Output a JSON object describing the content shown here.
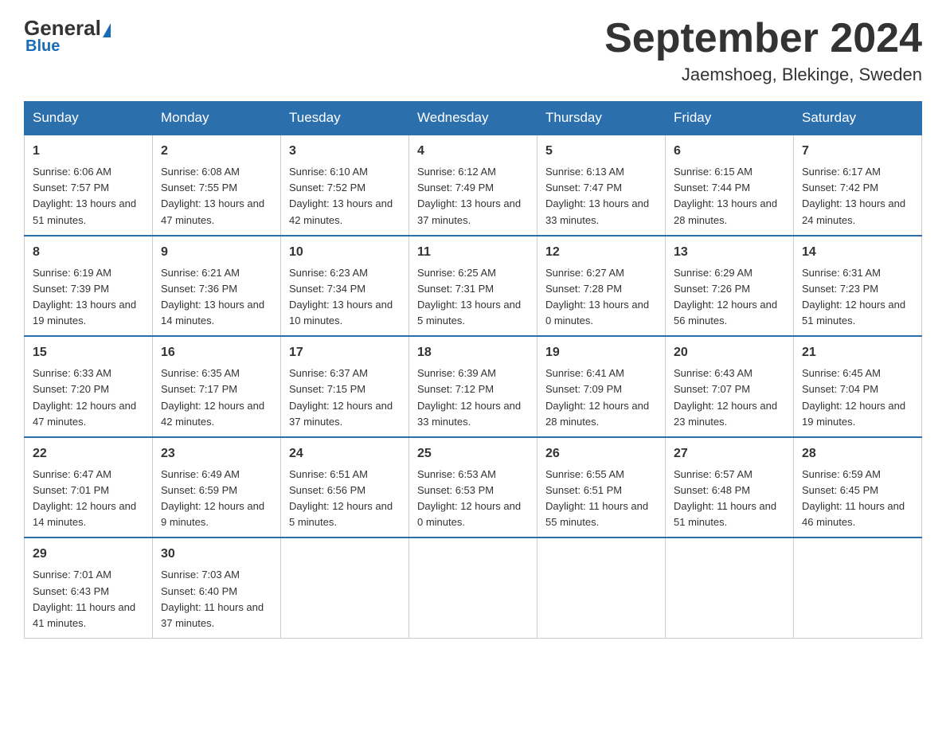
{
  "logo": {
    "general": "General",
    "blue": "Blue",
    "underline": "Blue"
  },
  "title": "September 2024",
  "location": "Jaemshoeg, Blekinge, Sweden",
  "days_of_week": [
    "Sunday",
    "Monday",
    "Tuesday",
    "Wednesday",
    "Thursday",
    "Friday",
    "Saturday"
  ],
  "weeks": [
    [
      {
        "day": "1",
        "sunrise": "6:06 AM",
        "sunset": "7:57 PM",
        "daylight": "13 hours and 51 minutes."
      },
      {
        "day": "2",
        "sunrise": "6:08 AM",
        "sunset": "7:55 PM",
        "daylight": "13 hours and 47 minutes."
      },
      {
        "day": "3",
        "sunrise": "6:10 AM",
        "sunset": "7:52 PM",
        "daylight": "13 hours and 42 minutes."
      },
      {
        "day": "4",
        "sunrise": "6:12 AM",
        "sunset": "7:49 PM",
        "daylight": "13 hours and 37 minutes."
      },
      {
        "day": "5",
        "sunrise": "6:13 AM",
        "sunset": "7:47 PM",
        "daylight": "13 hours and 33 minutes."
      },
      {
        "day": "6",
        "sunrise": "6:15 AM",
        "sunset": "7:44 PM",
        "daylight": "13 hours and 28 minutes."
      },
      {
        "day": "7",
        "sunrise": "6:17 AM",
        "sunset": "7:42 PM",
        "daylight": "13 hours and 24 minutes."
      }
    ],
    [
      {
        "day": "8",
        "sunrise": "6:19 AM",
        "sunset": "7:39 PM",
        "daylight": "13 hours and 19 minutes."
      },
      {
        "day": "9",
        "sunrise": "6:21 AM",
        "sunset": "7:36 PM",
        "daylight": "13 hours and 14 minutes."
      },
      {
        "day": "10",
        "sunrise": "6:23 AM",
        "sunset": "7:34 PM",
        "daylight": "13 hours and 10 minutes."
      },
      {
        "day": "11",
        "sunrise": "6:25 AM",
        "sunset": "7:31 PM",
        "daylight": "13 hours and 5 minutes."
      },
      {
        "day": "12",
        "sunrise": "6:27 AM",
        "sunset": "7:28 PM",
        "daylight": "13 hours and 0 minutes."
      },
      {
        "day": "13",
        "sunrise": "6:29 AM",
        "sunset": "7:26 PM",
        "daylight": "12 hours and 56 minutes."
      },
      {
        "day": "14",
        "sunrise": "6:31 AM",
        "sunset": "7:23 PM",
        "daylight": "12 hours and 51 minutes."
      }
    ],
    [
      {
        "day": "15",
        "sunrise": "6:33 AM",
        "sunset": "7:20 PM",
        "daylight": "12 hours and 47 minutes."
      },
      {
        "day": "16",
        "sunrise": "6:35 AM",
        "sunset": "7:17 PM",
        "daylight": "12 hours and 42 minutes."
      },
      {
        "day": "17",
        "sunrise": "6:37 AM",
        "sunset": "7:15 PM",
        "daylight": "12 hours and 37 minutes."
      },
      {
        "day": "18",
        "sunrise": "6:39 AM",
        "sunset": "7:12 PM",
        "daylight": "12 hours and 33 minutes."
      },
      {
        "day": "19",
        "sunrise": "6:41 AM",
        "sunset": "7:09 PM",
        "daylight": "12 hours and 28 minutes."
      },
      {
        "day": "20",
        "sunrise": "6:43 AM",
        "sunset": "7:07 PM",
        "daylight": "12 hours and 23 minutes."
      },
      {
        "day": "21",
        "sunrise": "6:45 AM",
        "sunset": "7:04 PM",
        "daylight": "12 hours and 19 minutes."
      }
    ],
    [
      {
        "day": "22",
        "sunrise": "6:47 AM",
        "sunset": "7:01 PM",
        "daylight": "12 hours and 14 minutes."
      },
      {
        "day": "23",
        "sunrise": "6:49 AM",
        "sunset": "6:59 PM",
        "daylight": "12 hours and 9 minutes."
      },
      {
        "day": "24",
        "sunrise": "6:51 AM",
        "sunset": "6:56 PM",
        "daylight": "12 hours and 5 minutes."
      },
      {
        "day": "25",
        "sunrise": "6:53 AM",
        "sunset": "6:53 PM",
        "daylight": "12 hours and 0 minutes."
      },
      {
        "day": "26",
        "sunrise": "6:55 AM",
        "sunset": "6:51 PM",
        "daylight": "11 hours and 55 minutes."
      },
      {
        "day": "27",
        "sunrise": "6:57 AM",
        "sunset": "6:48 PM",
        "daylight": "11 hours and 51 minutes."
      },
      {
        "day": "28",
        "sunrise": "6:59 AM",
        "sunset": "6:45 PM",
        "daylight": "11 hours and 46 minutes."
      }
    ],
    [
      {
        "day": "29",
        "sunrise": "7:01 AM",
        "sunset": "6:43 PM",
        "daylight": "11 hours and 41 minutes."
      },
      {
        "day": "30",
        "sunrise": "7:03 AM",
        "sunset": "6:40 PM",
        "daylight": "11 hours and 37 minutes."
      },
      null,
      null,
      null,
      null,
      null
    ]
  ],
  "labels": {
    "sunrise": "Sunrise:",
    "sunset": "Sunset:",
    "daylight": "Daylight:"
  }
}
